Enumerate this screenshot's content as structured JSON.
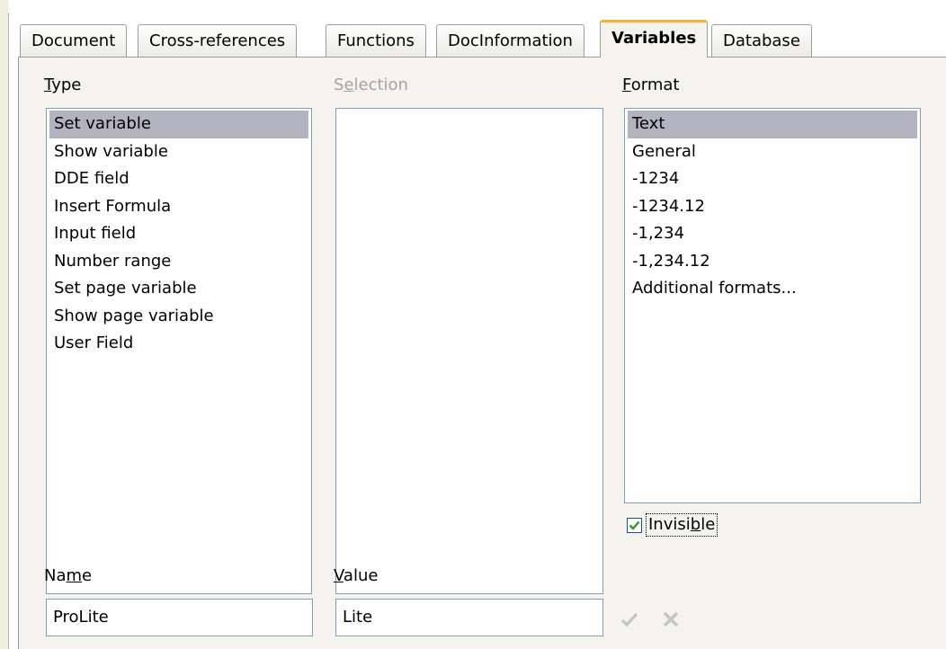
{
  "tabs": [
    {
      "label": "Document"
    },
    {
      "label": "Cross-references"
    },
    {
      "label": "Functions"
    },
    {
      "label": "DocInformation"
    },
    {
      "label": "Variables",
      "active": true
    },
    {
      "label": "Database"
    }
  ],
  "type": {
    "label_before": "",
    "label_mnemonic": "T",
    "label_after": "ype",
    "items": [
      "Set variable",
      "Show variable",
      "DDE field",
      "Insert Formula",
      "Input field",
      "Number range",
      "Set page variable",
      "Show page variable",
      "User Field"
    ],
    "selected": "Set variable"
  },
  "selection": {
    "label_before": "S",
    "label_mnemonic": "e",
    "label_after": "lection",
    "items": []
  },
  "format": {
    "label_before": "",
    "label_mnemonic": "F",
    "label_after": "ormat",
    "items": [
      "Text",
      "General",
      "-1234",
      "-1234.12",
      "-1,234",
      "-1,234.12",
      "Additional formats..."
    ],
    "selected": "Text"
  },
  "invisible": {
    "label_before": "Invisi",
    "label_mnemonic": "b",
    "label_after": "le",
    "checked": true
  },
  "name": {
    "label_before": "Na",
    "label_mnemonic": "m",
    "label_after": "e",
    "value": "ProLite"
  },
  "value": {
    "label_before": "",
    "label_mnemonic": "V",
    "label_after": "alue",
    "value": "Lite"
  },
  "icons": {
    "apply": "checkmark-icon",
    "delete": "delete-x-icon"
  },
  "colors": {
    "active_tab_accent": "#f7b030",
    "selected_item": "#b3b3c0",
    "panel_bg": "#f4f3ee",
    "list_border": "#7f9db9",
    "check_green": "#2f9a2a",
    "disabled_text": "#a3a3a3"
  }
}
